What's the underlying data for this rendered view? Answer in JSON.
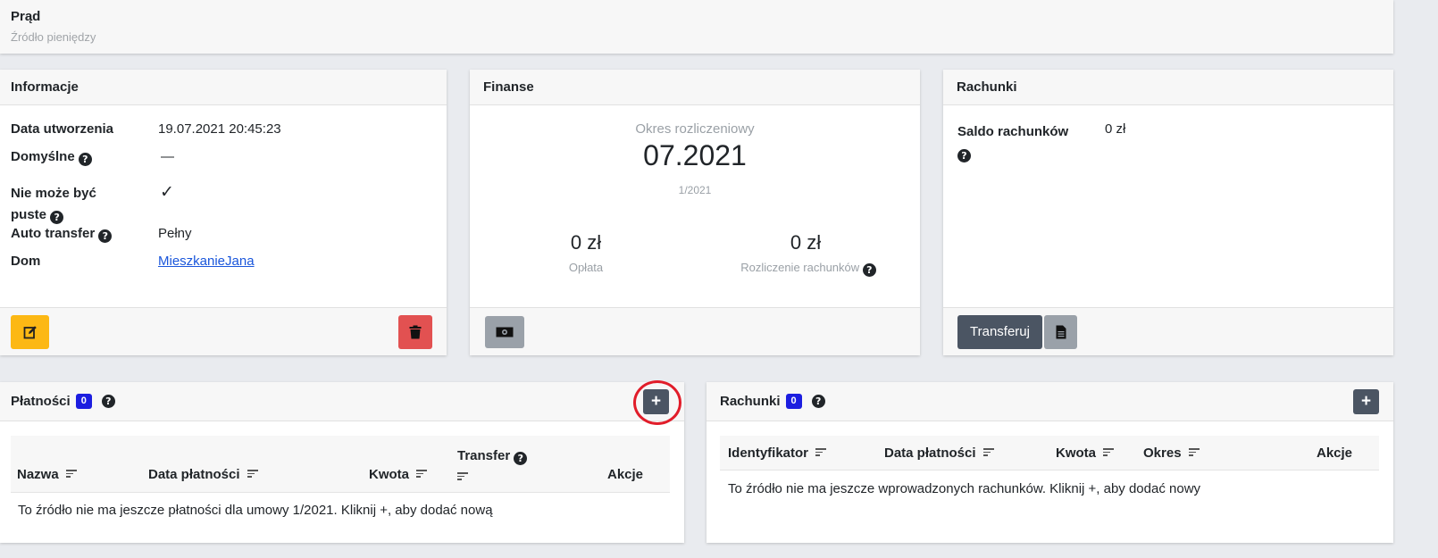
{
  "source": {
    "title": "Prąd",
    "subtitle": "Źródło pieniędzy"
  },
  "info": {
    "header": "Informacje",
    "rows": [
      {
        "label": "Data utworzenia",
        "value": "19.07.2021 20:45:23"
      },
      {
        "label": "Domyślne",
        "value": "—"
      },
      {
        "label_line1": "Nie może być",
        "label_line2": "puste",
        "value": "✓"
      },
      {
        "label": "Auto transfer",
        "value": "Pełny"
      },
      {
        "label": "Dom",
        "value": "MieszkanieJana"
      }
    ]
  },
  "finance": {
    "header": "Finanse",
    "period_label": "Okres rozliczeniowy",
    "period_value": "07.2021",
    "period_sub": "1/2021",
    "fee_value": "0 zł",
    "fee_label": "Opłata",
    "bills_value": "0 zł",
    "bills_label": "Rozliczenie rachunków"
  },
  "accounts_card": {
    "header": "Rachunki",
    "saldo_label": "Saldo rachunków",
    "saldo_value": "0 zł",
    "transfer_button": "Transferuj"
  },
  "payments": {
    "header": "Płatności",
    "badge": "0",
    "add_button": "+",
    "columns": {
      "name": "Nazwa",
      "date": "Data płatności",
      "amount": "Kwota",
      "transfer": "Transfer",
      "actions": "Akcje"
    },
    "empty": "To źródło nie ma jeszcze płatności dla umowy 1/2021. Kliknij +, aby dodać nową"
  },
  "bills": {
    "header": "Rachunki",
    "badge": "0",
    "add_button": "+",
    "columns": {
      "id": "Identyfikator",
      "date": "Data płatności",
      "amount": "Kwota",
      "period": "Okres",
      "actions": "Akcje"
    },
    "empty": "To źródło nie ma jeszcze wprowadzonych rachunków. Kliknij +, aby dodać nowy"
  },
  "colors": {
    "edit_button": "#fcb814",
    "delete_button": "#e25151",
    "secondary_button": "#4b5563",
    "light_button": "#9aa1a9",
    "link": "#1a56db",
    "badge": "#1c1ee0",
    "highlight": "#e11d2a"
  },
  "icons": {
    "edit": "edit-icon",
    "delete": "trash-icon",
    "money": "money-icon",
    "document": "document-icon",
    "help": "question-circle-icon",
    "sort": "sort-icon"
  }
}
